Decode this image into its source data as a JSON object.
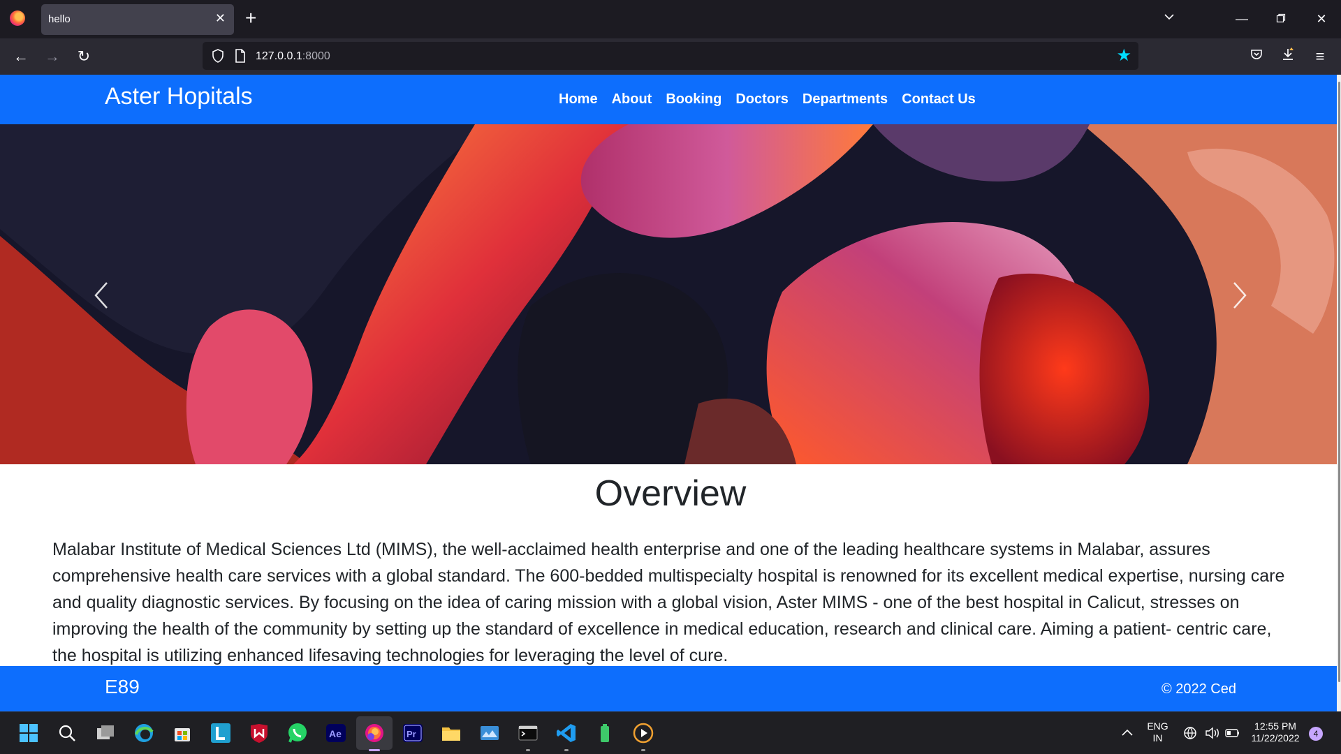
{
  "browser": {
    "tab_title": "hello",
    "url_host": "127.0.0.1",
    "url_port": ":8000"
  },
  "site": {
    "brand": "Aster Hopitals",
    "menu": [
      "Home",
      "About",
      "Booking",
      "Doctors",
      "Departments",
      "Contact Us"
    ]
  },
  "overview": {
    "title": "Overview",
    "text": "Malabar Institute of Medical Sciences Ltd (MIMS), the well-acclaimed health enterprise and one of the leading healthcare systems in Malabar, assures comprehensive health care services with a global standard. The 600-bedded multispecialty hospital is renowned for its excellent medical expertise, nursing care and quality diagnostic services. By focusing on the idea of caring mission with a global vision, Aster MIMS - one of the best hospital in Calicut, stresses on improving the health of the community by setting up the standard of excellence in medical education, research and clinical care. Aiming a patient- centric care, the hospital is utilizing enhanced lifesaving technologies for leveraging the level of cure."
  },
  "footer": {
    "left": "E89",
    "right": "© 2022 Ced"
  },
  "taskbar": {
    "lang_top": "ENG",
    "lang_bottom": "IN",
    "time": "12:55 PM",
    "date": "11/22/2022",
    "notifications": "4"
  },
  "colors": {
    "brand_blue": "#0d6efd",
    "browser_dark": "#1c1b22"
  }
}
